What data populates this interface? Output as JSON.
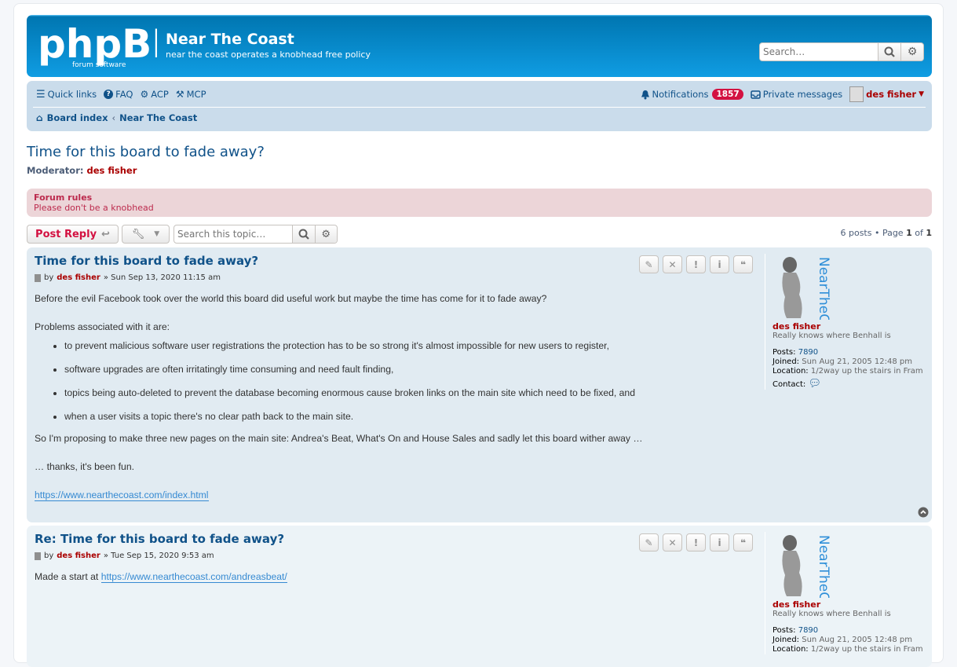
{
  "header": {
    "logo_text": "phpBB",
    "logo_sub": "forum software",
    "site_title": "Near The Coast",
    "site_desc": "near the coast operates a knobhead free policy",
    "search_placeholder": "Search…"
  },
  "nav": {
    "quick_links": "Quick links",
    "faq": "FAQ",
    "acp": "ACP",
    "mcp": "MCP",
    "notifications": "Notifications",
    "notifications_count": "1857",
    "private_messages": "Private messages",
    "username": "des fisher"
  },
  "breadcrumb": {
    "board_index": "Board index",
    "forum": "Near The Coast"
  },
  "topic": {
    "title": "Time for this board to fade away?",
    "moderator_label": "Moderator:",
    "moderator": "des fisher"
  },
  "rules": {
    "title": "Forum rules",
    "text": "Please don't be a knobhead"
  },
  "actionbar": {
    "post_reply": "Post Reply",
    "search_placeholder": "Search this topic…",
    "pagination_prefix": "6 posts • Page",
    "page": "1",
    "of": "of",
    "total_pages": "1"
  },
  "posts": [
    {
      "title": "Time for this board to fade away?",
      "by": "by",
      "author": "des fisher",
      "date": "» Sun Sep 13, 2020 11:15 am",
      "p1": "Before the evil Facebook took over the world this board did useful work but maybe the time has come for it to fade away?",
      "p2": "Problems associated with it are:",
      "items": [
        "to prevent malicious software user registrations the protection has to be so strong it's almost impossible for new users to register,",
        "software upgrades are often irritatingly time consuming and need fault finding,",
        "topics being auto-deleted to prevent the database becoming enormous cause broken links on the main site which need to be fixed, and",
        "when a user visits a topic there's no clear path back to the main site."
      ],
      "p3": "So I'm proposing to make three new pages on the main site: Andrea's Beat, What's On and House Sales and sadly let this board wither away …",
      "p4": "… thanks, it's been fun.",
      "link": "https://www.nearthecoast.com/index.html"
    },
    {
      "title": "Re: Time for this board to fade away?",
      "by": "by",
      "author": "des fisher",
      "date": "» Tue Sep 15, 2020 9:53 am",
      "text": "Made a start at",
      "link": "https://www.nearthecoast.com/andreasbeat/"
    }
  ],
  "profile": {
    "avatar_text": "NearTheCoast",
    "name": "des fisher",
    "rank": "Really knows where Benhall is",
    "posts_label": "Posts:",
    "posts": "7890",
    "joined_label": "Joined:",
    "joined": "Sun Aug 21, 2005 12:48 pm",
    "location_label": "Location:",
    "location": "1/2way up the stairs in Fram",
    "contact_label": "Contact:"
  },
  "colors": {
    "header_blue": "#0076b1",
    "nav_bg": "#cadceb",
    "post_bg": "#e1ebf2",
    "username_red": "#aa0000",
    "link_blue": "#105289",
    "badge_red": "#d31141"
  }
}
